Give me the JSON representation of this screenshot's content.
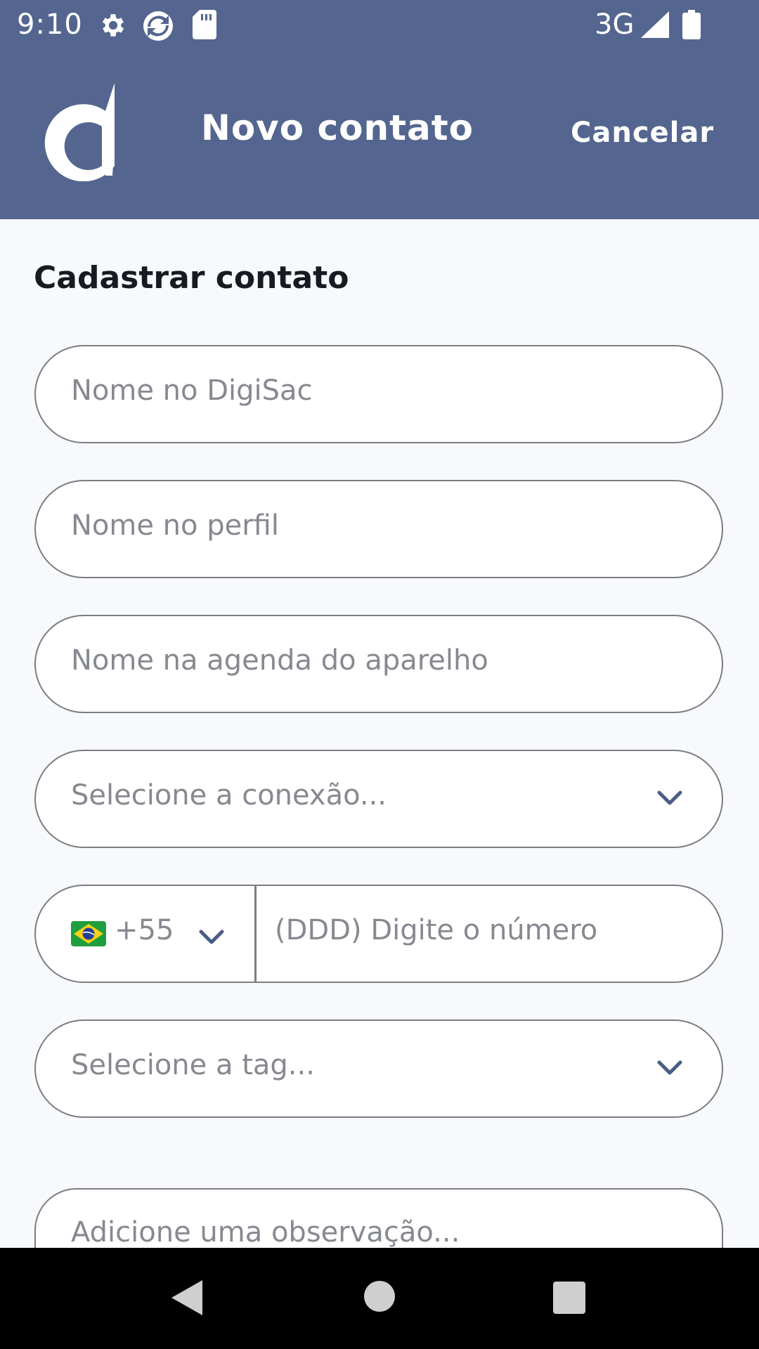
{
  "status_bar": {
    "time": "9:10",
    "network": "3G",
    "icons": [
      "gear-icon",
      "sync-app-icon",
      "sd-card-icon",
      "signal-icon",
      "battery-icon"
    ]
  },
  "header": {
    "title": "Novo contato",
    "cancel_label": "Cancelar",
    "logo": "digisac-logo"
  },
  "form": {
    "section_title": "Cadastrar contato",
    "name_digisac_placeholder": "Nome no DigiSac",
    "name_profile_placeholder": "Nome no perfil",
    "name_agenda_placeholder": "Nome na agenda do aparelho",
    "connection_placeholder": "Selecione a conexão...",
    "phone": {
      "country_flag": "brazil-flag",
      "country_code": "+55",
      "number_placeholder": "(DDD) Digite o número"
    },
    "tag_placeholder": "Selecione a tag...",
    "observation_placeholder": "Adicione uma observação..."
  },
  "nav_bar": {
    "buttons": [
      "back-icon",
      "home-icon",
      "recents-icon"
    ]
  },
  "colors": {
    "header_bg": "#54668f",
    "page_bg": "#f7f9fc",
    "field_border": "#7b7d82",
    "placeholder": "#878991",
    "chevron": "#4a5d86"
  }
}
